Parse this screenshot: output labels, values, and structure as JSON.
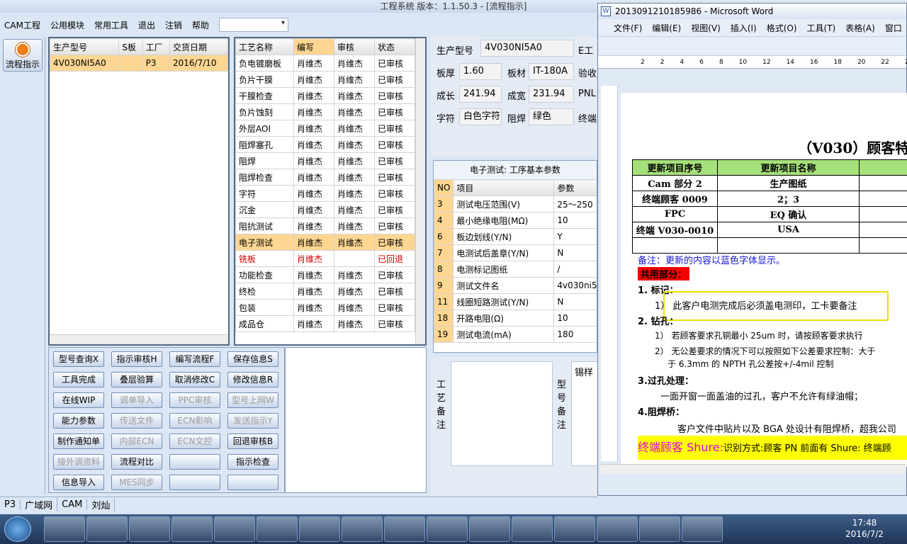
{
  "app": {
    "title": "工程系统   版本：1.1.50.3 - [流程指示]"
  },
  "menu": [
    "CAM工程",
    "公用模块",
    "常用工具",
    "退出",
    "注销",
    "帮助"
  ],
  "side_button": "流程指示",
  "order_table": {
    "headers": [
      "生产型号",
      "S板",
      "工厂",
      "交货日期"
    ],
    "row": [
      "4V030NI5A0",
      "",
      "P3",
      "2016/7/10"
    ]
  },
  "process_table": {
    "headers": [
      "工艺名称",
      "编写",
      "审核",
      "状态"
    ],
    "rows": [
      [
        "负电镀磨板",
        "肖维杰",
        "肖维杰",
        "已审核"
      ],
      [
        "负片干膜",
        "肖维杰",
        "肖维杰",
        "已审核"
      ],
      [
        "干膜检查",
        "肖维杰",
        "肖维杰",
        "已审核"
      ],
      [
        "负片蚀刻",
        "肖维杰",
        "肖维杰",
        "已审核"
      ],
      [
        "外层AOI",
        "肖维杰",
        "肖维杰",
        "已审核"
      ],
      [
        "阻焊塞孔",
        "肖维杰",
        "肖维杰",
        "已审核"
      ],
      [
        "阻焊",
        "肖维杰",
        "肖维杰",
        "已审核"
      ],
      [
        "阻焊检查",
        "肖维杰",
        "肖维杰",
        "已审核"
      ],
      [
        "字符",
        "肖维杰",
        "肖维杰",
        "已审核"
      ],
      [
        "沉金",
        "肖维杰",
        "肖维杰",
        "已审核"
      ],
      [
        "阻抗测试",
        "肖维杰",
        "肖维杰",
        "已审核"
      ],
      [
        "电子测试",
        "肖维杰",
        "肖维杰",
        "已审核"
      ],
      [
        "铣板",
        "肖维杰",
        "",
        "已回退"
      ],
      [
        "功能检查",
        "肖维杰",
        "肖维杰",
        "已审核"
      ],
      [
        "终检",
        "肖维杰",
        "肖维杰",
        "已审核"
      ],
      [
        "包装",
        "肖维杰",
        "肖维杰",
        "已审核"
      ],
      [
        "成品仓",
        "肖维杰",
        "肖维杰",
        "已审核"
      ]
    ]
  },
  "buttons": [
    [
      "型号查询X",
      "指示审核H",
      "编写流程F",
      "保存信息S"
    ],
    [
      "工具完成",
      "叠层验算",
      "取消修改C",
      "修改信息R"
    ],
    [
      "在线WIP",
      "调单导入",
      "PPC审核",
      "型号上网W"
    ],
    [
      "能力参数",
      "传送文件",
      "ECN影响",
      "发送指示Y"
    ],
    [
      "制作通知单",
      "内部ECN",
      "ECN文控",
      "回退审核B"
    ],
    [
      "接外调资料",
      "流程对比",
      "",
      "指示检查"
    ],
    [
      "信息导入",
      "MES同步",
      "",
      ""
    ]
  ],
  "buttons_disabled": [
    "调单导入",
    "PPC审核",
    "型号上网W",
    "传送文件",
    "ECN影响",
    "发送指示Y",
    "内部ECN",
    "ECN文控",
    "接外调资料",
    "MES同步"
  ],
  "info": {
    "model_label": "生产型号",
    "model": "4V030NI5A0",
    "e_label": "E工",
    "thick_label": "板厚",
    "thick": "1.60",
    "mat_label": "板材",
    "mat": "IT-180A",
    "check_label": "验收",
    "len_label": "成长",
    "len": "241.94",
    "wid_label": "成宽",
    "wid": "231.94",
    "pnl_label": "PNL",
    "char_label": "字符",
    "char": "白色字符",
    "mask_label": "阻焊",
    "mask": "绿色",
    "end_label": "终端"
  },
  "test": {
    "title": "电子测试: 工序基本参数",
    "headers": [
      "NO",
      "项目",
      "参数"
    ],
    "rows": [
      [
        "3",
        "测试电压范围(V)",
        "25～250"
      ],
      [
        "4",
        "最小绝缘电阻(MΩ)",
        "10"
      ],
      [
        "6",
        "板边划线(Y/N)",
        "Y"
      ],
      [
        "7",
        "电测试后盖章(Y/N)",
        "N"
      ],
      [
        "8",
        "电测标记图纸",
        "/"
      ],
      [
        "9",
        "测试文件名",
        "4v030ni5a"
      ],
      [
        "11",
        "线圈短路测试(Y/N)",
        "N"
      ],
      [
        "18",
        "开路电阻(Ω)",
        "10"
      ],
      [
        "19",
        "测试电流(mA)",
        "180"
      ]
    ]
  },
  "notes": {
    "process_label": "工艺备注",
    "model_label": "型号备注",
    "sample_label": "锡样"
  },
  "status": [
    "P3",
    "广域网",
    "CAM",
    "刘灿"
  ],
  "taskbar": {
    "time": "17:48",
    "date": "2016/7/2"
  },
  "word": {
    "title": "2013091210185986 - Microsoft Word",
    "menu": [
      "文件(F)",
      "编辑(E)",
      "视图(V)",
      "插入(I)",
      "格式(O)",
      "工具(T)",
      "表格(A)",
      "窗口"
    ],
    "ruler": [
      "2",
      "2",
      "4",
      "6",
      "8",
      "10",
      "12",
      "14",
      "16",
      "18",
      "20",
      "22",
      "24",
      "26"
    ],
    "doc_title": "（V030）顾客特",
    "table_headers": [
      "更新项目序号",
      "更新项目名称"
    ],
    "table_rows": [
      [
        "Cam 部分 2",
        "生产图纸"
      ],
      [
        "终端顾客 0009",
        "2；3"
      ],
      [
        "FPC",
        "EQ 确认"
      ],
      [
        "终端 V030-0010",
        "USA"
      ]
    ],
    "note": "备注：更新的内容以蓝色字体显示。",
    "common": "共用部分：",
    "sec1": "1.   标记：",
    "item1": "1）  此客户电测完成后必须盖电测印，工卡要备注",
    "sec2": "2.   钻孔：",
    "item2": "1）  若顾客要求孔铜最小 25um 时，请按顾客要求执行",
    "item3": "2）  无公差要求的情况下可以按照如下公差要求控制：大于",
    "item3b": "于 6.3mm 的 NPTH 孔公差按+/-4mil 控制",
    "sec3": "3.过孔处理：",
    "item4": "一面开窗一面盖油的过孔，客户不允许有绿油帽；",
    "sec4": "4.阻焊桥：",
    "item5": "客户文件中贴片以及 BGA 处设计有阻焊桥，超我公司",
    "shure": "终端顾客 Shure:",
    "shure_text": "识别方式:顾客 PN 前面有 Shure: 终端顾"
  }
}
